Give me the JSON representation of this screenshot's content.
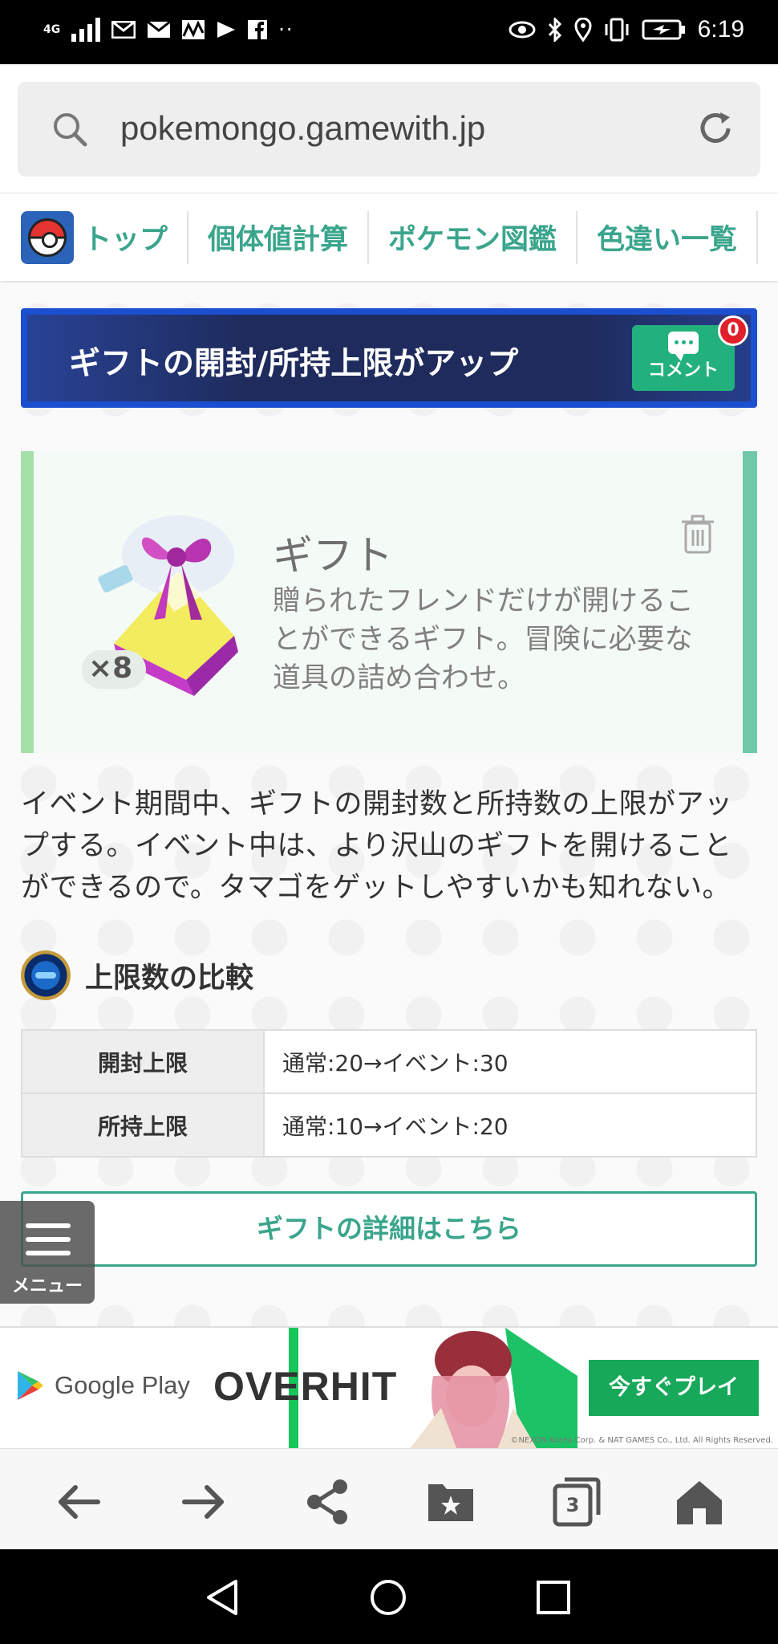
{
  "status_bar": {
    "network": "4G",
    "time": "6:19",
    "more_indicator": "··"
  },
  "browser": {
    "url": "pokemongo.gamewith.jp",
    "tabs_count": "3"
  },
  "site_nav": {
    "items": [
      {
        "label": "トップ",
        "icon": "pokeball-logo"
      },
      {
        "label": "個体値計算"
      },
      {
        "label": "ポケモン図鑑"
      },
      {
        "label": "色違い一覧"
      }
    ]
  },
  "banner": {
    "title": "ギフトの開封/所持上限がアップ",
    "comment_label": "コメント",
    "comment_count": "0"
  },
  "gift_card": {
    "count": "×8",
    "title": "ギフト",
    "description": "贈られたフレンドだけが開けることができるギフト。冒険に必要な道具の詰め合わせ。"
  },
  "body_text": "イベント期間中、ギフトの開封数と所持数の上限がアップする。イベント中は、より沢山のギフトを開けることができるので。タマゴをゲットしやすいかも知れない。",
  "compare": {
    "heading": "上限数の比較",
    "rows": [
      {
        "label": "開封上限",
        "value": "通常:20→イベント:30"
      },
      {
        "label": "所持上限",
        "value": "通常:10→イベント:20"
      }
    ]
  },
  "detail_button": "ギフトの詳細はこちら",
  "menu_label": "メニュー",
  "ad": {
    "store": "Google Play",
    "brand": "OVERHIT",
    "cta": "今すぐプレイ",
    "copyright": "©NEXON Korea Corp. & NAT GAMES Co., Ltd. All Rights Reserved."
  },
  "colors": {
    "accent": "#3aa58c",
    "banner_bg": "#1e2b5c",
    "ad_cta": "#17a85a",
    "badge": "#e0202a"
  }
}
